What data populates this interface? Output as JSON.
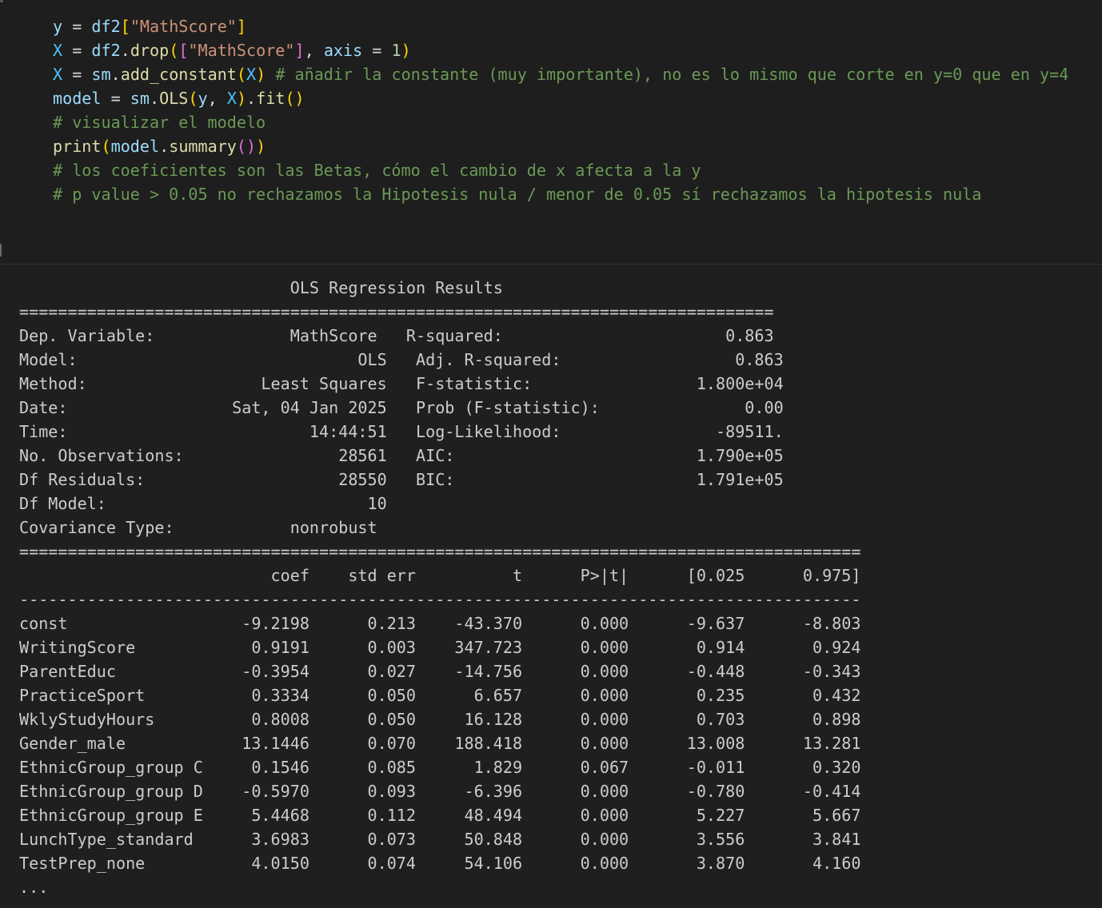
{
  "code": {
    "l1": {
      "y": "y",
      "eq": " = ",
      "df": "df2",
      "br_open": "[",
      "str": "\"MathScore\"",
      "br_close": "]"
    },
    "l2": {
      "X": "X",
      "eq": " = ",
      "df": "df2",
      "dot": ".",
      "fn": "drop",
      "p_open": "(",
      "b_open": "[",
      "str": "\"MathScore\"",
      "b_close": "]",
      "comma": ", ",
      "kw": "axis",
      "eq2": " = ",
      "num": "1",
      "p_close": ")"
    },
    "l3": {
      "X": "X",
      "eq": " = ",
      "sm": "sm",
      "dot": ".",
      "fn": "add_constant",
      "p_open": "(",
      "arg": "X",
      "p_close": ")",
      "comment": " # añadir la constante (muy importante), no es lo mismo que corte en y=0 que en y=4"
    },
    "l4": {
      "model": "model",
      "eq": " = ",
      "sm": "sm",
      "dot": ".",
      "cls": "OLS",
      "p_open": "(",
      "a1": "y",
      "comma": ", ",
      "a2": "X",
      "p_close": ")",
      "dot2": ".",
      "fn": "fit",
      "p2": "()"
    },
    "l5": {
      "comment": "# visualizar el modelo"
    },
    "l6": {
      "fn": "print",
      "p_open": "(",
      "model": "model",
      "dot": ".",
      "fn2": "summary",
      "p2": "()",
      "p_close": ")"
    },
    "l7": {
      "comment": "# los coeficientes son las Betas, cómo el cambio de x afecta a la y"
    },
    "l8": {
      "comment": "# p value > 0.05 no rechazamos la Hipotesis nula / menor de 0.05 sí rechazamos la hipotesis nula"
    }
  },
  "output": {
    "lines": [
      "                            OLS Regression Results                            ",
      "==============================================================================",
      "Dep. Variable:              MathScore   R-squared:                       0.863",
      "Model:                             OLS   Adj. R-squared:                  0.863",
      "Method:                  Least Squares   F-statistic:                 1.800e+04",
      "Date:                 Sat, 04 Jan 2025   Prob (F-statistic):               0.00",
      "Time:                         14:44:51   Log-Likelihood:                -89511.",
      "No. Observations:                28561   AIC:                         1.790e+05",
      "Df Residuals:                    28550   BIC:                         1.791e+05",
      "Df Model:                           10                                         ",
      "Covariance Type:            nonrobust                                         ",
      "=======================================================================================",
      "                          coef    std err          t      P>|t|      [0.025      0.975]",
      "---------------------------------------------------------------------------------------",
      "const                  -9.2198      0.213    -43.370      0.000      -9.637      -8.803",
      "WritingScore            0.9191      0.003    347.723      0.000       0.914       0.924",
      "ParentEduc             -0.3954      0.027    -14.756      0.000      -0.448      -0.343",
      "PracticeSport           0.3334      0.050      6.657      0.000       0.235       0.432",
      "WklyStudyHours          0.8008      0.050     16.128      0.000       0.703       0.898",
      "Gender_male            13.1446      0.070    188.418      0.000      13.008      13.281",
      "EthnicGroup_group C     0.1546      0.085      1.829      0.067      -0.011       0.320",
      "EthnicGroup_group D    -0.5970      0.093     -6.396      0.000      -0.780      -0.414",
      "EthnicGroup_group E     5.4468      0.112     48.494      0.000       5.227       5.667",
      "LunchType_standard      3.6983      0.073     50.848      0.000       3.556       3.841",
      "TestPrep_none           4.0150      0.074     54.106      0.000       3.870       4.160",
      "..."
    ]
  }
}
